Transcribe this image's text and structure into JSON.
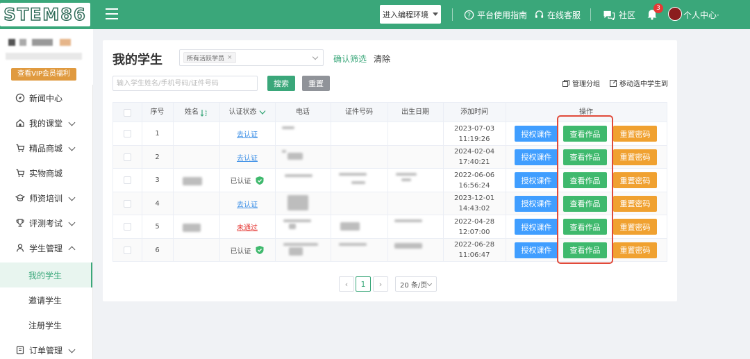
{
  "header": {
    "logo_text": "STEM86",
    "env_button": "进入编程环境",
    "guide_link": "平台使用指南",
    "service_link": "在线客服",
    "community_link": "社区",
    "notification_count": "3",
    "user_center": "个人中心·"
  },
  "sidebar": {
    "vip_button": "查看VIP会员福利",
    "items": [
      {
        "label": "新闻中心"
      },
      {
        "label": "我的课堂"
      },
      {
        "label": "精品商城"
      },
      {
        "label": "实物商城"
      },
      {
        "label": "师资培训"
      },
      {
        "label": "评测考试"
      },
      {
        "label": "学生管理"
      },
      {
        "label": "订单管理"
      }
    ],
    "sub_items": [
      {
        "label": "我的学生"
      },
      {
        "label": "邀请学生"
      },
      {
        "label": "注册学生"
      }
    ]
  },
  "main": {
    "title": "我的学生",
    "filter_tag": "所有活跃学员",
    "confirm_filter": "确认筛选",
    "clear": "清除",
    "search_placeholder": "输入学生姓名/手机号码/证件号码",
    "search_button": "搜索",
    "reset_button": "重置",
    "manage_group": "管理分组",
    "move_selected": "移动选中学生到"
  },
  "table": {
    "columns": [
      "序号",
      "姓名",
      "认证状态",
      "电话",
      "证件号码",
      "出生日期",
      "添加时间",
      "操作"
    ],
    "rows": [
      {
        "no": "1",
        "cert": "去认证",
        "cert_type": "link",
        "date": "2023-07-03",
        "time": "11:19:26"
      },
      {
        "no": "2",
        "cert": "去认证",
        "cert_type": "link",
        "date": "2024-02-04",
        "time": "17:40:21"
      },
      {
        "no": "3",
        "cert": "已认证",
        "cert_type": "ok",
        "date": "2022-06-06",
        "time": "16:56:24"
      },
      {
        "no": "4",
        "cert": "去认证",
        "cert_type": "link",
        "date": "2023-12-01",
        "time": "14:43:02"
      },
      {
        "no": "5",
        "cert": "未通过",
        "cert_type": "fail",
        "date": "2022-04-28",
        "time": "12:07:00"
      },
      {
        "no": "6",
        "cert": "已认证",
        "cert_type": "ok",
        "date": "2022-06-28",
        "time": "11:06:47"
      }
    ],
    "actions": {
      "authorize": "授权课件",
      "view": "查看作品",
      "reset_pwd": "重置密码"
    }
  },
  "pagination": {
    "current_page": "1",
    "page_size": "20 条/页"
  },
  "colors": {
    "brand": "#3aa77a",
    "action_blue": "#409eff",
    "action_green": "#3fb96d",
    "action_orange": "#f0a130",
    "highlight": "#e04a3a"
  }
}
